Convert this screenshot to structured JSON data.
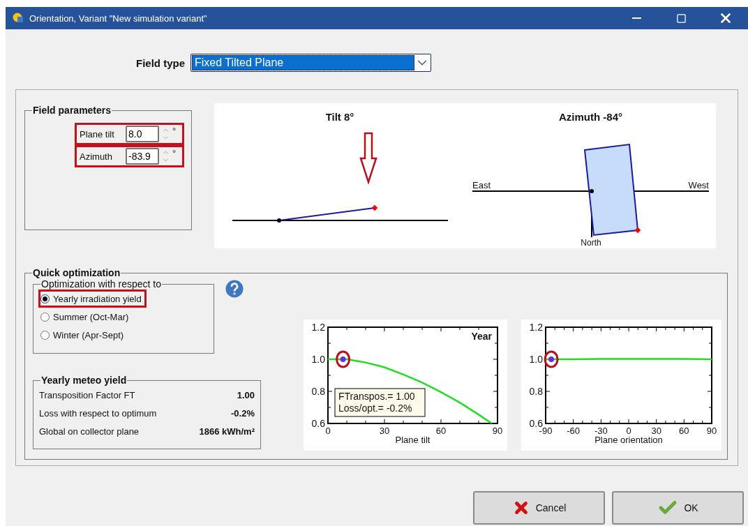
{
  "window": {
    "title": "Orientation, Variant \"New simulation variant\""
  },
  "field_type": {
    "label": "Field type",
    "value": "Fixed Tilted Plane"
  },
  "field_parameters": {
    "title": "Field parameters",
    "fields": [
      {
        "label": "Plane tilt",
        "value": "8.0",
        "unit": "°",
        "highlighted": true
      },
      {
        "label": "Azimuth",
        "value": "-83.9",
        "unit": "°",
        "highlighted": true
      }
    ]
  },
  "diagrams": [
    {
      "kind": "tilt",
      "title": "Tilt 8°"
    },
    {
      "kind": "azimuth",
      "title": "Azimuth -84°",
      "labels": [
        "East",
        "West",
        "North"
      ]
    }
  ],
  "quick_optimization": {
    "title": "Quick optimization",
    "criterion": {
      "title": "Optimization with respect to",
      "options": [
        {
          "label": "Yearly irradiation yield",
          "selected": true,
          "highlighted": true
        },
        {
          "label": "Summer (Oct-Mar)",
          "selected": false,
          "highlighted": false
        },
        {
          "label": "Winter (Apr-Sept)",
          "selected": false,
          "highlighted": false
        }
      ]
    },
    "meteo_yield": {
      "title": "Yearly meteo yield",
      "rows": [
        {
          "label": "Transposition Factor FT",
          "value": "1.00"
        },
        {
          "label": "Loss with respect to optimum",
          "value": "-0.2%"
        },
        {
          "label": "Global on collector plane",
          "value": "1866 kWh/m²"
        }
      ]
    },
    "charts": [
      {
        "highlighted": true,
        "note": [
          "FTranspos.= 1.00",
          "Loss/opt.= -0.2%"
        ],
        "chart_data": {
          "type": "line",
          "title": "Year",
          "xlabel": "Plane tilt",
          "x": [
            0,
            10,
            20,
            30,
            40,
            50,
            60,
            70,
            80,
            87
          ],
          "series": [
            {
              "color": "#22dd22",
              "values": [
                1.0,
                1.0,
                0.98,
                0.95,
                0.905,
                0.855,
                0.795,
                0.73,
                0.655,
                0.6
              ]
            }
          ],
          "xlim": [
            0,
            90
          ],
          "ylim": [
            0.6,
            1.2
          ],
          "xticks": [
            0,
            30,
            60,
            90
          ],
          "yticks": [
            0.6,
            0.8,
            {
              "value": 1,
              "label": "1.0"
            },
            1.2
          ]
        }
      },
      {
        "highlighted": true,
        "chart_data": {
          "type": "line",
          "xlabel": "Plane orientation",
          "x": [
            -90,
            -60,
            -30,
            0,
            30,
            60,
            90
          ],
          "series": [
            {
              "color": "#22dd22",
              "values": [
                1.0,
                1.0,
                1.002,
                1.002,
                1.002,
                1.002,
                1.0
              ]
            }
          ],
          "xlim": [
            -90,
            90
          ],
          "ylim": [
            0.6,
            1.2
          ],
          "xticks": [
            -90,
            -60,
            -30,
            0,
            30,
            60,
            90
          ],
          "yticks": [
            0.6,
            0.8,
            {
              "value": 1,
              "label": "1.0"
            },
            1.2
          ]
        }
      }
    ]
  },
  "buttons": [
    {
      "kind": "cancel",
      "label": "Cancel"
    },
    {
      "kind": "ok",
      "label": "OK"
    }
  ]
}
